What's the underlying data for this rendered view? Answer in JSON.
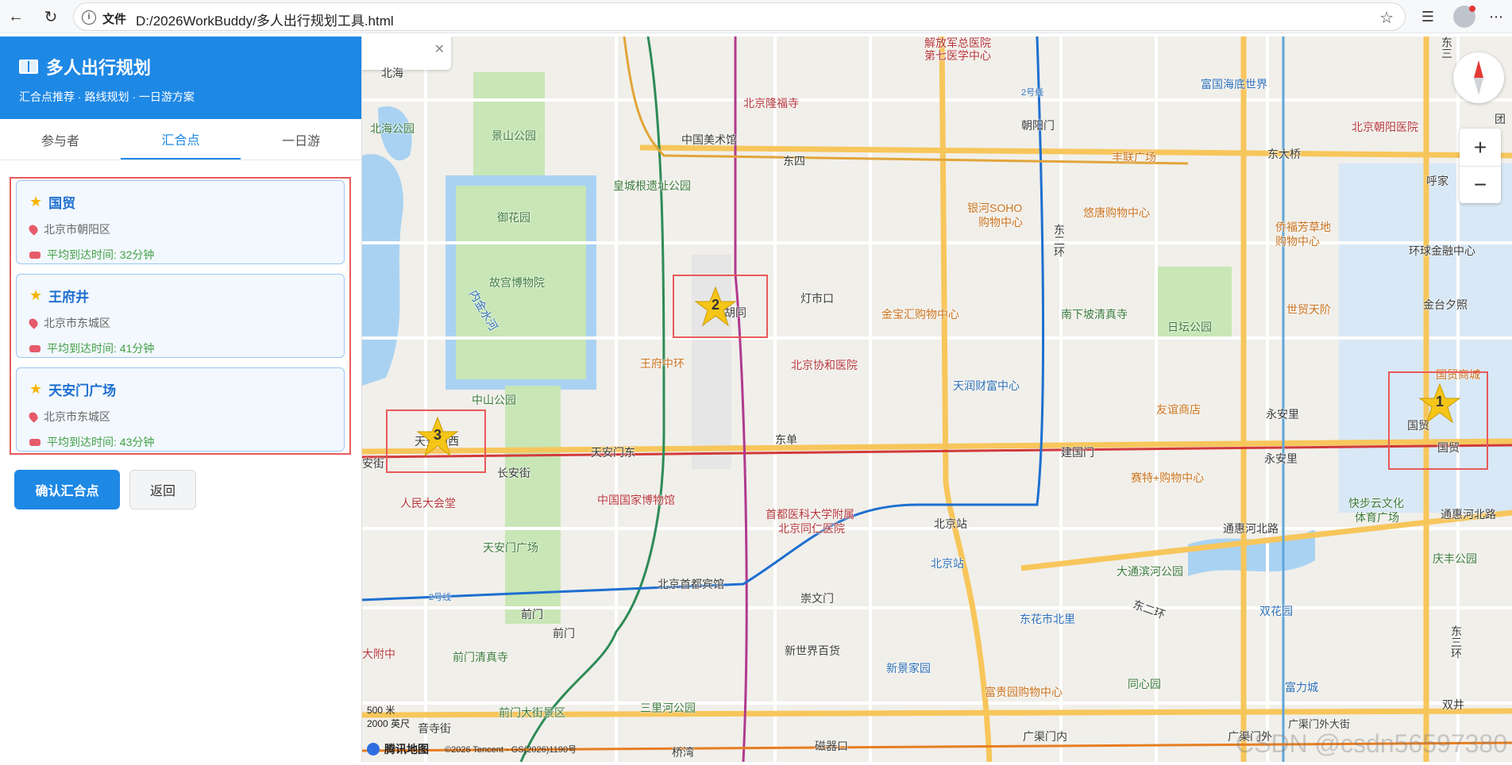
{
  "browser": {
    "scheme_label": "文件",
    "url": "D:/2026WorkBuddy/多人出行规划工具.html"
  },
  "sidebar": {
    "title": "多人出行规划",
    "subtitle": "汇合点推荐 · 路线规划 · 一日游方案",
    "tabs": [
      {
        "label": "参与者",
        "active": false
      },
      {
        "label": "汇合点",
        "active": true
      },
      {
        "label": "一日游",
        "active": false
      }
    ],
    "cards": [
      {
        "name": "国贸",
        "address": "北京市朝阳区",
        "time": "平均到达时间: 32分钟"
      },
      {
        "name": "王府井",
        "address": "北京市东城区",
        "time": "平均到达时间: 41分钟"
      },
      {
        "name": "天安门广场",
        "address": "北京市东城区",
        "time": "平均到达时间: 43分钟"
      }
    ],
    "confirm_label": "确认汇合点",
    "back_label": "返回"
  },
  "map": {
    "popup_text": "北海",
    "markers": [
      "1",
      "2",
      "3"
    ],
    "labels": {
      "l1": "解放军总医院",
      "l2": "第七医学中心",
      "l3": "北京隆福寺",
      "l4": "中国美术馆",
      "l5": "景山公园",
      "l6": "北海公园",
      "l7": "东四",
      "l8": "朝阳门",
      "l9": "富国海底世界",
      "l10": "北京朝阳医院",
      "l11": "丰联广场",
      "l12": "东大桥",
      "l13": "皇城根遗址公园",
      "l14": "御花园",
      "l15": "故宫博物院",
      "l16": "内金水河",
      "l17": "银河SOHO",
      "l18": "购物中心",
      "l19": "悠唐购物中心",
      "l20": "侨福芳草地",
      "l21": "购物中心",
      "l22": "环球金融中心",
      "l23": "灯市口",
      "l24": "胡同",
      "l25": "金宝汇购物中心",
      "l26": "南下坡清真寺",
      "l27": "日坛公园",
      "l28": "世贸天阶",
      "l29": "金台夕照",
      "l30": "王府中环",
      "l31": "北京协和医院",
      "l32": "天润财富中心",
      "l33": "国贸商城",
      "l34": "中山公园",
      "l35": "友谊商店",
      "l36": "永安里",
      "l37": "国贸",
      "l38": "天安门西",
      "l39": "天安门东",
      "l40": "东单",
      "l41": "建国门",
      "l42": "永安里",
      "l43": "国贸",
      "l44": "长安街",
      "l45": "赛特+购物中心",
      "l46": "人民大会堂",
      "l47": "中国国家博物馆",
      "l48": "首都医科大学附属",
      "l49": "北京同仁医院",
      "l50": "北京站",
      "l51": "通惠河北路",
      "l52": "快步云文化",
      "l53": "体育广场",
      "l54": "通惠河北路",
      "l55": "天安门广场",
      "l56": "北京站",
      "l57": "大通滨河公园",
      "l58": "庆丰公园",
      "l59": "北京首都宾馆",
      "l60": "崇文门",
      "l61": "2号线",
      "l62": "2号线",
      "l63": "前门",
      "l64": "前门",
      "l65": "东花市北里",
      "l66": "东二环",
      "l67": "双花园",
      "l68": "大附中",
      "l69": "前门清真寺",
      "l70": "新世界百货",
      "l71": "新景家园",
      "l72": "同心园",
      "l73": "富力城",
      "l74": "前门大街景区",
      "l75": "三里河公园",
      "l76": "富贵园购物中心",
      "l77": "广渠门外大街",
      "l78": "双井",
      "l79": "桥湾",
      "l80": "磁器口",
      "l81": "广渠门内",
      "l82": "广渠门外",
      "l83": "东二环",
      "l84": "东三环",
      "l85": "安街",
      "l86": "团",
      "l87": "呼家",
      "l88": "东三",
      "l89": "音寺街"
    },
    "scale_1": "500 米",
    "scale_2": "2000 英尺",
    "logo_text": "腾讯地图",
    "copyright": "©2026 Tencent - GS(2026)1190号",
    "watermark": "CSDN @csdn56597380",
    "colors": {
      "road_major": "#f7c65b",
      "subway_red": "#d23a3a",
      "subway_blue": "#1e6fd0",
      "subway_green": "#2e8b57",
      "subway_purple": "#b03a8e",
      "park": "#c8e6b6",
      "water": "#a9d2f2"
    }
  }
}
